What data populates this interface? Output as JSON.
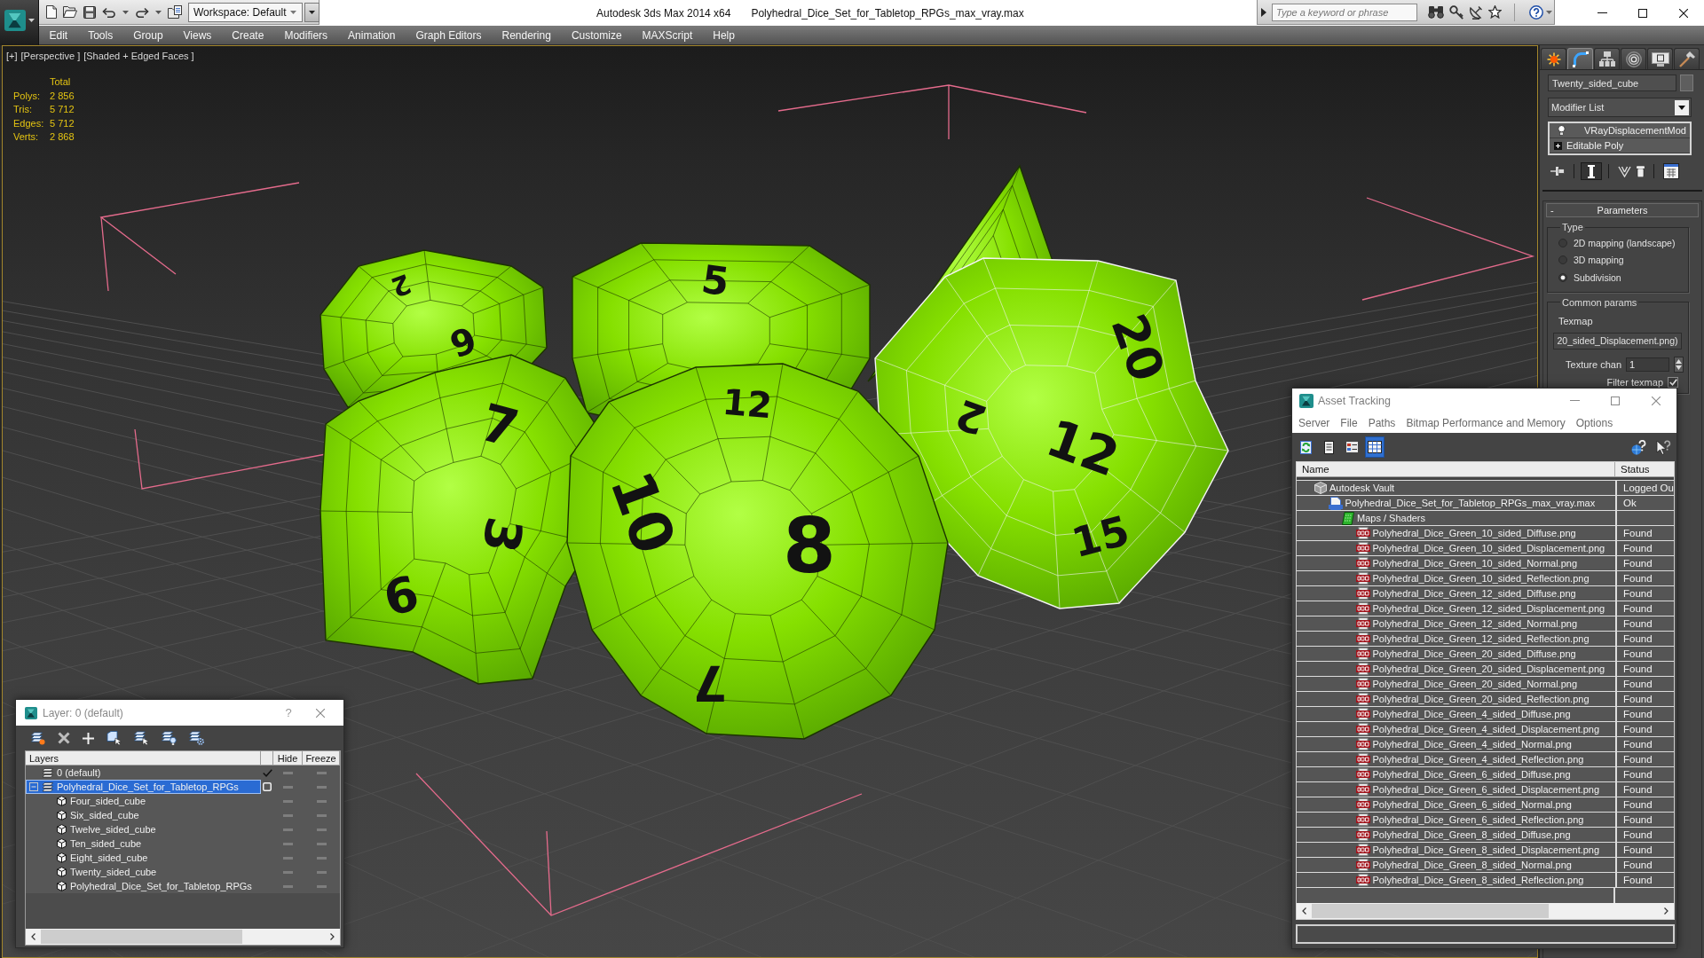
{
  "title_bar": {
    "workspace": "Workspace: Default",
    "app_title": "Autodesk 3ds Max 2014 x64",
    "file_title": "Polyhedral_Dice_Set_for_Tabletop_RPGs_max_vray.max",
    "search": {
      "placeholder": "Type a keyword or phrase"
    }
  },
  "menu": [
    "Edit",
    "Tools",
    "Group",
    "Views",
    "Create",
    "Modifiers",
    "Animation",
    "Graph Editors",
    "Rendering",
    "Customize",
    "MAXScript",
    "Help"
  ],
  "viewport": {
    "labels": [
      "[+]",
      "[Perspective ]",
      "[Shaded + Edged Faces ]"
    ],
    "stats": {
      "header": "Total",
      "rows": [
        {
          "label": "Polys:",
          "value": "2 856"
        },
        {
          "label": "Tris:",
          "value": "5 712"
        },
        {
          "label": "Edges:",
          "value": "5 712"
        },
        {
          "label": "Verts:",
          "value": "2 868"
        }
      ]
    },
    "dice": [
      {
        "kind": "d4",
        "selected": false
      },
      {
        "kind": "d10",
        "selected": false,
        "numbers": [
          "2",
          "9"
        ]
      },
      {
        "kind": "d6",
        "selected": false,
        "numbers": [
          "5"
        ]
      },
      {
        "kind": "d20",
        "selected": true,
        "numbers": [
          "2",
          "20",
          "12",
          "15"
        ]
      },
      {
        "kind": "d8",
        "selected": false,
        "numbers": [
          "7",
          "3",
          "6"
        ]
      },
      {
        "kind": "d12",
        "selected": false,
        "numbers": [
          "12",
          "10",
          "8",
          "7"
        ]
      }
    ]
  },
  "layer_dialog": {
    "title": "Layer: 0 (default)",
    "help": "?",
    "columns": [
      "Layers",
      "Hide",
      "Freeze"
    ],
    "layers": [
      {
        "kind": "layer",
        "name": "0 (default)",
        "current": true,
        "selected": false,
        "hidden": false,
        "frozen": false
      },
      {
        "kind": "layer",
        "name": "Polyhedral_Dice_Set_for_Tabletop_RPGs",
        "current": false,
        "selected": true,
        "expanded": true,
        "hidden": false,
        "frozen": false,
        "children": [
          {
            "kind": "object",
            "name": "Four_sided_cube",
            "selected": false,
            "hidden": false,
            "frozen": false
          },
          {
            "kind": "object",
            "name": "Six_sided_cube",
            "selected": false,
            "hidden": false,
            "frozen": false
          },
          {
            "kind": "object",
            "name": "Twelve_sided_cube",
            "selected": false,
            "hidden": false,
            "frozen": false
          },
          {
            "kind": "object",
            "name": "Ten_sided_cube",
            "selected": false,
            "hidden": false,
            "frozen": false
          },
          {
            "kind": "object",
            "name": "Eight_sided_cube",
            "selected": false,
            "hidden": false,
            "frozen": false
          },
          {
            "kind": "object",
            "name": "Twenty_sided_cube",
            "selected": false,
            "hidden": false,
            "frozen": false
          },
          {
            "kind": "object",
            "name": "Polyhedral_Dice_Set_for_Tabletop_RPGs",
            "selected": false,
            "hidden": false,
            "frozen": false
          }
        ]
      }
    ]
  },
  "asset_tracking": {
    "title": "Asset Tracking",
    "menu": [
      "Server",
      "File",
      "Paths",
      "Bitmap Performance and Memory",
      "Options"
    ],
    "toolbar": [
      {
        "kind": "refresh",
        "selected": false
      },
      {
        "kind": "list",
        "selected": false
      },
      {
        "kind": "table",
        "selected": false
      },
      {
        "kind": "grid",
        "selected": true
      }
    ],
    "columns": [
      "Name",
      "Status"
    ],
    "tree": [
      {
        "kind": "vault",
        "name": "Autodesk Vault",
        "status": "Logged Ou",
        "children": [
          {
            "kind": "max",
            "name": "Polyhedral_Dice_Set_for_Tabletop_RPGs_max_vray.max",
            "status": "Ok",
            "children": [
              {
                "kind": "folder",
                "name": "Maps / Shaders",
                "children": [
                  {
                    "kind": "png",
                    "name": "Polyhedral_Dice_Green_10_sided_Diffuse.png",
                    "status": "Found"
                  },
                  {
                    "kind": "png",
                    "name": "Polyhedral_Dice_Green_10_sided_Displacement.png",
                    "status": "Found"
                  },
                  {
                    "kind": "png",
                    "name": "Polyhedral_Dice_Green_10_sided_Normal.png",
                    "status": "Found"
                  },
                  {
                    "kind": "png",
                    "name": "Polyhedral_Dice_Green_10_sided_Reflection.png",
                    "status": "Found"
                  },
                  {
                    "kind": "png",
                    "name": "Polyhedral_Dice_Green_12_sided_Diffuse.png",
                    "status": "Found"
                  },
                  {
                    "kind": "png",
                    "name": "Polyhedral_Dice_Green_12_sided_Displacement.png",
                    "status": "Found"
                  },
                  {
                    "kind": "png",
                    "name": "Polyhedral_Dice_Green_12_sided_Normal.png",
                    "status": "Found"
                  },
                  {
                    "kind": "png",
                    "name": "Polyhedral_Dice_Green_12_sided_Reflection.png",
                    "status": "Found"
                  },
                  {
                    "kind": "png",
                    "name": "Polyhedral_Dice_Green_20_sided_Diffuse.png",
                    "status": "Found"
                  },
                  {
                    "kind": "png",
                    "name": "Polyhedral_Dice_Green_20_sided_Displacement.png",
                    "status": "Found"
                  },
                  {
                    "kind": "png",
                    "name": "Polyhedral_Dice_Green_20_sided_Normal.png",
                    "status": "Found"
                  },
                  {
                    "kind": "png",
                    "name": "Polyhedral_Dice_Green_20_sided_Reflection.png",
                    "status": "Found"
                  },
                  {
                    "kind": "png",
                    "name": "Polyhedral_Dice_Green_4_sided_Diffuse.png",
                    "status": "Found"
                  },
                  {
                    "kind": "png",
                    "name": "Polyhedral_Dice_Green_4_sided_Displacement.png",
                    "status": "Found"
                  },
                  {
                    "kind": "png",
                    "name": "Polyhedral_Dice_Green_4_sided_Normal.png",
                    "status": "Found"
                  },
                  {
                    "kind": "png",
                    "name": "Polyhedral_Dice_Green_4_sided_Reflection.png",
                    "status": "Found"
                  },
                  {
                    "kind": "png",
                    "name": "Polyhedral_Dice_Green_6_sided_Diffuse.png",
                    "status": "Found"
                  },
                  {
                    "kind": "png",
                    "name": "Polyhedral_Dice_Green_6_sided_Displacement.png",
                    "status": "Found"
                  },
                  {
                    "kind": "png",
                    "name": "Polyhedral_Dice_Green_6_sided_Normal.png",
                    "status": "Found"
                  },
                  {
                    "kind": "png",
                    "name": "Polyhedral_Dice_Green_6_sided_Reflection.png",
                    "status": "Found"
                  },
                  {
                    "kind": "png",
                    "name": "Polyhedral_Dice_Green_8_sided_Diffuse.png",
                    "status": "Found"
                  },
                  {
                    "kind": "png",
                    "name": "Polyhedral_Dice_Green_8_sided_Displacement.png",
                    "status": "Found"
                  },
                  {
                    "kind": "png",
                    "name": "Polyhedral_Dice_Green_8_sided_Normal.png",
                    "status": "Found"
                  },
                  {
                    "kind": "png",
                    "name": "Polyhedral_Dice_Green_8_sided_Reflection.png",
                    "status": "Found"
                  }
                ]
              }
            ]
          }
        ]
      }
    ]
  },
  "command_panel": {
    "tabs": [
      {
        "kind": "create",
        "selected": false
      },
      {
        "kind": "modify",
        "selected": true
      },
      {
        "kind": "hierarchy",
        "selected": false
      },
      {
        "kind": "motion",
        "selected": false
      },
      {
        "kind": "display",
        "selected": false
      },
      {
        "kind": "utilities",
        "selected": false
      }
    ],
    "object_name": "Twenty_sided_cube",
    "modifier_list": "Modifier List",
    "stack": [
      {
        "kind": "modifier",
        "name": "VRayDisplacementMod"
      },
      {
        "kind": "base",
        "name": "Editable Poly"
      }
    ],
    "stack_tools": [
      {
        "kind": "pin",
        "pressed": false
      },
      {
        "kind": "end-result",
        "pressed": true
      },
      {
        "kind": "unique",
        "pressed": false
      },
      {
        "kind": "remove",
        "pressed": false
      },
      {
        "kind": "configure",
        "pressed": false
      }
    ],
    "rollout": {
      "sign": "-",
      "title": "Parameters",
      "type_group": {
        "label": "Type",
        "options": [
          {
            "label": "2D mapping (landscape)",
            "selected": false
          },
          {
            "label": "3D mapping",
            "selected": false
          },
          {
            "label": "Subdivision",
            "selected": true
          }
        ]
      },
      "common_group": {
        "label": "Common params",
        "texmap_label": "Texmap",
        "texmap_button": "20_sided_Displacement.png)",
        "texture_chan": {
          "label": "Texture chan",
          "value": "1"
        },
        "filter_texmap": {
          "label": "Filter texmap",
          "checked": true
        }
      }
    }
  }
}
